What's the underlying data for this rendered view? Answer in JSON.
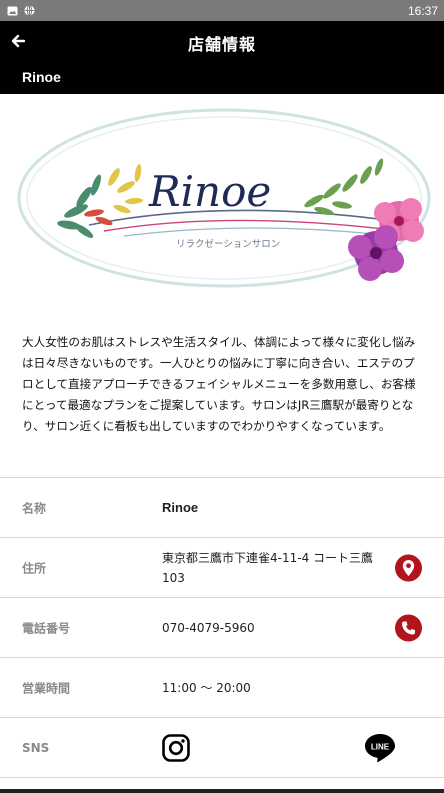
{
  "status_bar": {
    "time": "16:37"
  },
  "header": {
    "title": "店舗情報",
    "shop_name": "Rinoe"
  },
  "logo": {
    "name": "Rinoe",
    "subtitle": "リラクゼーションサロン"
  },
  "description": "大人女性のお肌はストレスや生活スタイル、体調によって様々に変化し悩みは日々尽きないものです。一人ひとりの悩みに丁寧に向き合い、エステのプロとして直接アプローチできるフェイシャルメニューを多数用意し、お客様にとって最適なプランをご提案しています。サロンはJR三鷹駅が最寄りとなり、サロン近くに看板も出していますのでわかりやすくなっています。",
  "info": {
    "name_label": "名称",
    "name_value": "Rinoe",
    "address_label": "住所",
    "address_value": "東京都三鷹市下連雀4-11-4 コート三鷹103",
    "phone_label": "電話番号",
    "phone_value": "070-4079-5960",
    "hours_label": "営業時間",
    "hours_value": "11:00 〜 20:00",
    "sns_label": "SNS"
  },
  "icons": {
    "back": "arrow-left-icon",
    "map": "map-pin-icon",
    "phone": "phone-icon",
    "instagram": "instagram-icon",
    "line": "line-icon"
  },
  "colors": {
    "header_bg": "#000000",
    "accent_red": "#b1141a",
    "status_bar": "#7a7a7a"
  }
}
